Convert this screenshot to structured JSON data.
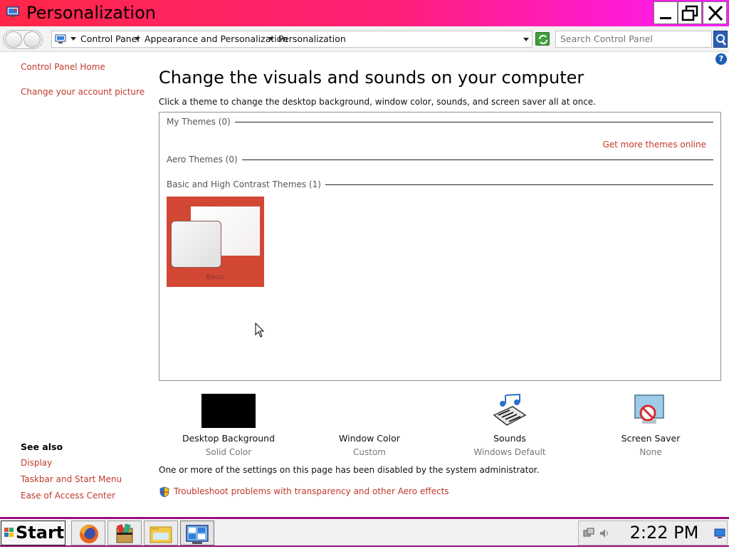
{
  "window": {
    "title": "Personalization"
  },
  "address_bar": {
    "breadcrumbs": [
      "Control Panel",
      "Appearance and Personalization",
      "Personalization"
    ],
    "search_placeholder": "Search Control Panel"
  },
  "left_pane": {
    "links": [
      "Control Panel Home",
      "Change your account picture"
    ],
    "see_also_heading": "See also",
    "see_also_links": [
      "Display",
      "Taskbar and Start Menu",
      "Ease of Access Center"
    ]
  },
  "main": {
    "heading": "Change the visuals and sounds on your computer",
    "subtitle": "Click a theme to change the desktop background, window color, sounds, and screen saver all at once.",
    "groups": {
      "my_themes": "My Themes (0)",
      "aero_themes": "Aero Themes (0)",
      "basic_themes": "Basic and High Contrast Themes (1)"
    },
    "get_more_link": "Get more themes online",
    "theme_tile_name": "Basic"
  },
  "settings": [
    {
      "label": "Desktop Background",
      "value": "Solid Color"
    },
    {
      "label": "Window Color",
      "value": "Custom"
    },
    {
      "label": "Sounds",
      "value": "Windows Default"
    },
    {
      "label": "Screen Saver",
      "value": "None"
    }
  ],
  "disabled_note": "One or more of the settings on this page has been disabled by the system administrator.",
  "troubleshoot_link": "Troubleshoot problems with transparency and other Aero effects",
  "taskbar": {
    "start_label": "Start",
    "clock": "2:22 PM"
  },
  "colors": {
    "title_gradient_start": "#ff2747",
    "title_gradient_end": "#ff1aff",
    "link_color": "#c0392b",
    "taskbar_border": "#9b0f7f",
    "theme_tile": "#d34735"
  }
}
